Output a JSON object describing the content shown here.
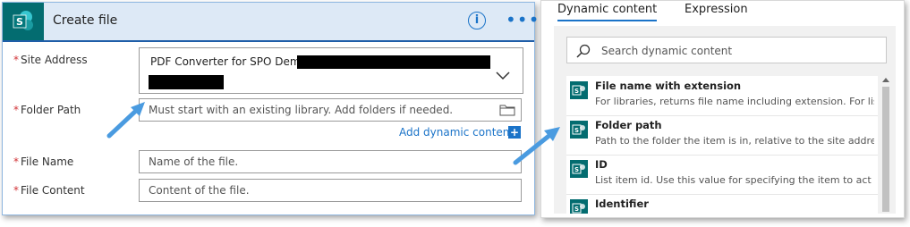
{
  "card": {
    "title": "Create file",
    "info_glyph": "i",
    "more_glyph": "•••",
    "icon": "sharepoint-icon"
  },
  "fields": {
    "site_address": {
      "label": "Site Address",
      "required": "*",
      "value": "PDF Converter for SPO Demo -"
    },
    "folder_path": {
      "label": "Folder Path",
      "required": "*",
      "placeholder": "Must start with an existing library. Add folders if needed."
    },
    "file_name": {
      "label": "File Name",
      "required": "*",
      "placeholder": "Name of the file."
    },
    "file_content": {
      "label": "File Content",
      "required": "*",
      "placeholder": "Content of the file."
    }
  },
  "add_dynamic": {
    "label": "Add dynamic content",
    "plus": "+"
  },
  "panel": {
    "tabs": [
      "Dynamic content",
      "Expression"
    ],
    "active_tab": "Dynamic content",
    "search_placeholder": "Search dynamic content",
    "items": [
      {
        "name": "File name with extension",
        "description": "For libraries, returns file name including extension. For list..."
      },
      {
        "name": "Folder path",
        "description": "Path to the folder the item is in, relative to the site address."
      },
      {
        "name": "ID",
        "description": "List item id. Use this value for specifying the item to act o..."
      },
      {
        "name": "Identifier",
        "description": ""
      }
    ]
  },
  "colors": {
    "sharepoint": "#036c70",
    "accent": "#1a73c8",
    "required": "#d13438",
    "arrow": "#4a9be0"
  }
}
